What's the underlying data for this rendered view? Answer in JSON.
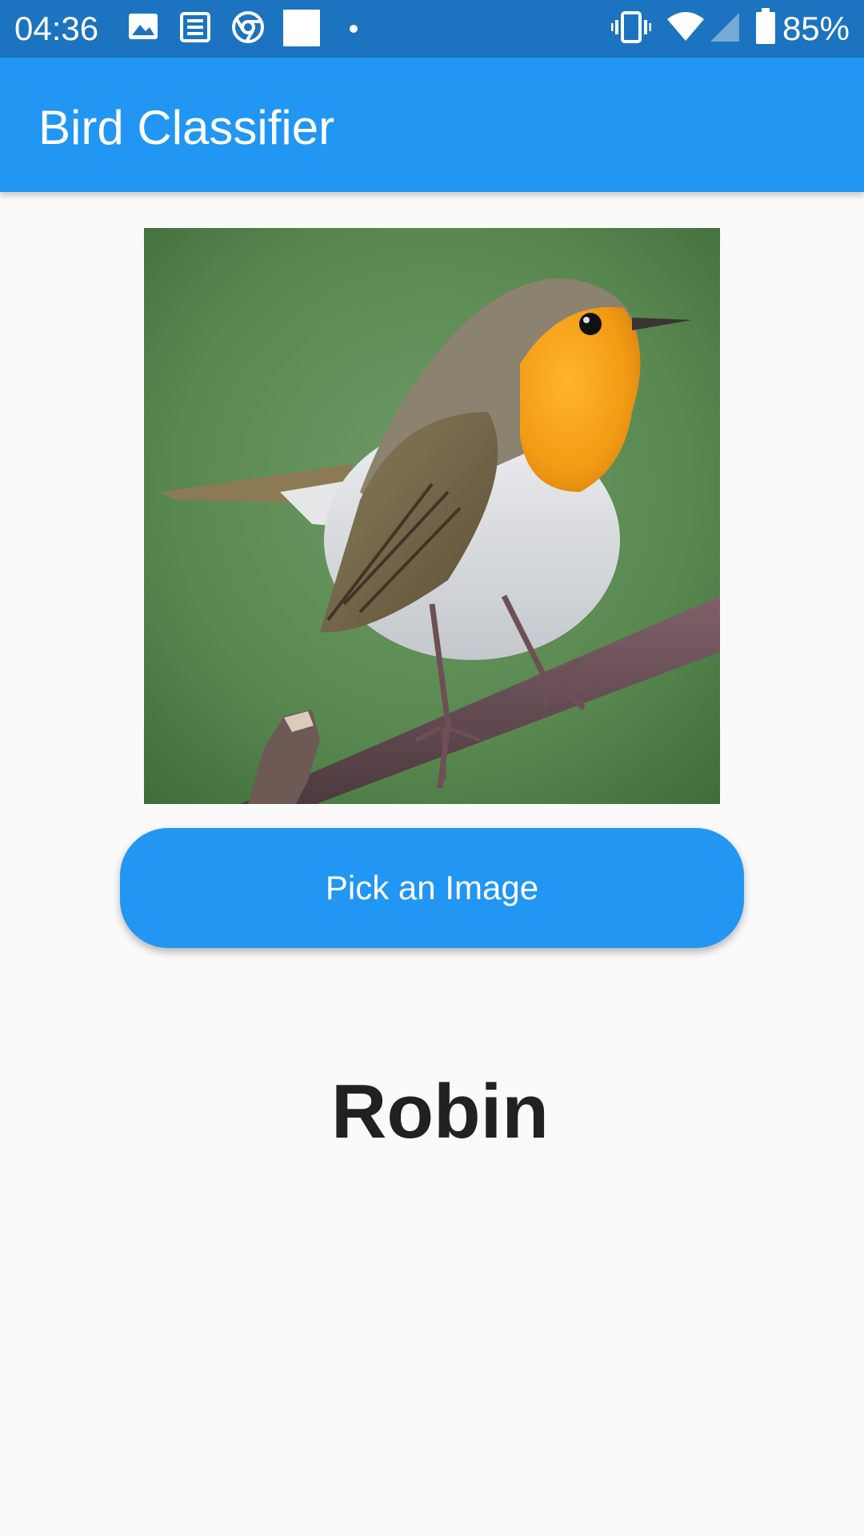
{
  "status_bar": {
    "time": "04:36",
    "battery_percent": "85%",
    "background_color": "#1c73bf",
    "left_icons": [
      "image-icon",
      "news-icon",
      "chrome-icon",
      "square-notification-icon",
      "dot-icon"
    ],
    "right_icons": [
      "vibrate-icon",
      "wifi-icon",
      "signal-icon",
      "battery-icon"
    ]
  },
  "app_bar": {
    "title": "Bird Classifier",
    "color": "#2196f3"
  },
  "main": {
    "image_subject": "robin photo",
    "pick_button_label": "Pick an Image",
    "result": "Robin"
  }
}
